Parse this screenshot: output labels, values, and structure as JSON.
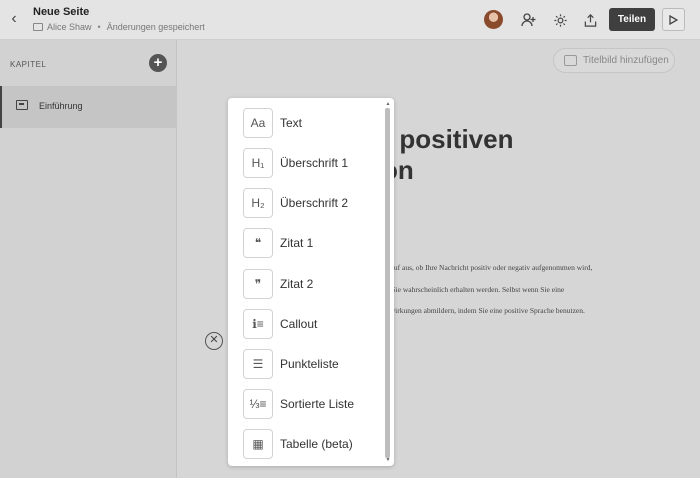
{
  "header": {
    "title": "Neue Seite",
    "author": "Alice Shaw",
    "separator": "•",
    "status": "Änderungen gespeichert",
    "share_label": "Teilen",
    "icons": [
      "chevron-left-icon",
      "folder-icon",
      "add-user-icon",
      "gear-icon",
      "upload-icon",
      "play-icon"
    ]
  },
  "sidebar": {
    "section_label": "KAPITEL",
    "items": [
      {
        "label": "Einführung",
        "icon": "chapter-icon"
      }
    ]
  },
  "editor": {
    "cover_button_label": "Titelbild hinzufügen",
    "heading_lines": [
      "r positiven",
      "on"
    ],
    "body_lines": [
      "sich darauf aus, ob Ihre Nachricht positiv oder negativ aufgenommen wird,",
      "ton, die Sie wahrscheinlich erhalten werden. Selbst wenn Sie eine",
      "die Auswirkungen abmildern, indem Sie eine positive Sprache benutzen."
    ]
  },
  "menu": {
    "items": [
      {
        "label": "Text",
        "icon_glyph": "Aa",
        "icon": "text-icon"
      },
      {
        "label": "Überschrift 1",
        "icon_glyph": "H₁",
        "icon": "heading1-icon"
      },
      {
        "label": "Überschrift 2",
        "icon_glyph": "H₂",
        "icon": "heading2-icon"
      },
      {
        "label": "Zitat 1",
        "icon_glyph": "❝",
        "icon": "quote1-icon"
      },
      {
        "label": "Zitat 2",
        "icon_glyph": "❞",
        "icon": "quote2-icon"
      },
      {
        "label": "Callout",
        "icon_glyph": "ℹ≡",
        "icon": "callout-icon"
      },
      {
        "label": "Punkteliste",
        "icon_glyph": "☰",
        "icon": "bullet-list-icon"
      },
      {
        "label": "Sortierte Liste",
        "icon_glyph": "⅓≡",
        "icon": "numbered-list-icon"
      },
      {
        "label": "Tabelle (beta)",
        "icon_glyph": "▦",
        "icon": "table-icon"
      }
    ]
  }
}
